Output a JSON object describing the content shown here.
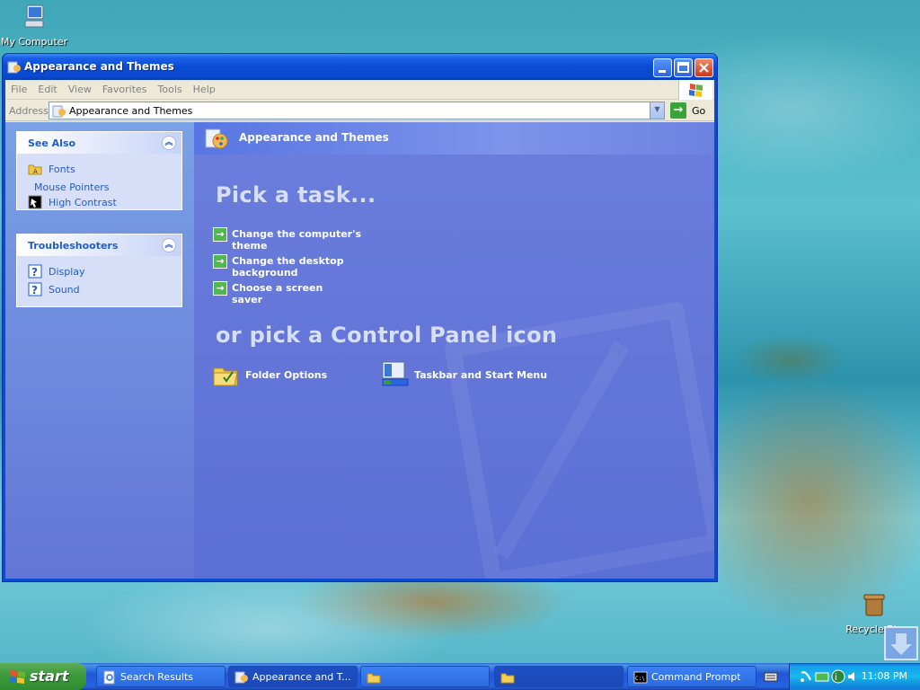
{
  "desktop": {
    "icons": [
      {
        "label": "My Computer"
      },
      {
        "label": "Recycle Bin"
      }
    ]
  },
  "window": {
    "title": "Appearance and Themes",
    "menu": [
      "File",
      "Edit",
      "View",
      "Favorites",
      "Tools",
      "Help"
    ],
    "address": {
      "label": "Address",
      "value": "Appearance and Themes",
      "go": "Go"
    }
  },
  "sidebar": {
    "see_also": {
      "title": "See Also",
      "items": [
        {
          "label": "Fonts",
          "icon": "folder-fonts-icon"
        },
        {
          "label": "Mouse Pointers",
          "icon": ""
        },
        {
          "label": "High Contrast",
          "icon": "high-contrast-icon"
        }
      ]
    },
    "troubleshooters": {
      "title": "Troubleshooters",
      "items": [
        {
          "label": "Display",
          "icon": "help-icon"
        },
        {
          "label": "Sound",
          "icon": "help-icon"
        }
      ]
    }
  },
  "main": {
    "header": "Appearance and Themes",
    "pick_task": "Pick a task...",
    "tasks": [
      "Change the computer's theme",
      "Change the desktop background",
      "Choose a screen saver"
    ],
    "pick_icon": "or pick a Control Panel icon",
    "icons": [
      {
        "label": "Folder Options"
      },
      {
        "label": "Taskbar and Start Menu"
      }
    ]
  },
  "taskbar": {
    "start": "start",
    "buttons": [
      {
        "label": "Search Results"
      },
      {
        "label": "Appearance and T..."
      },
      {
        "label": ""
      },
      {
        "label": ""
      },
      {
        "label": "Command Prompt"
      }
    ],
    "clock": "11:08 PM"
  },
  "colors": {
    "title_blue": "#0a4bd4",
    "task_link": "#215dc6",
    "content_bg": "#6375d6",
    "start_green": "#3c9a3c"
  }
}
